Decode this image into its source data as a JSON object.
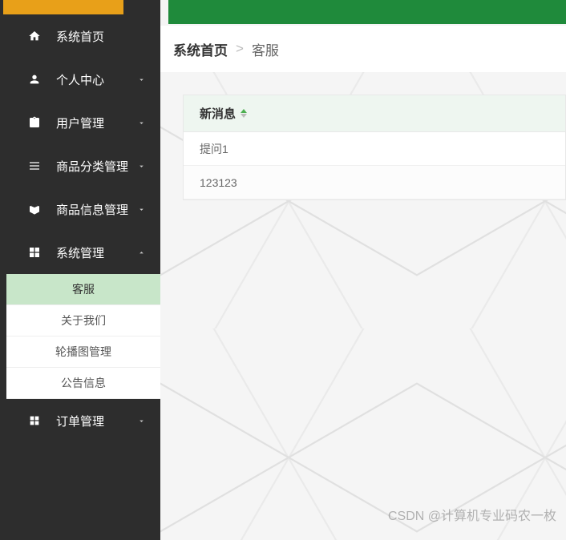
{
  "sidebar": {
    "items": [
      {
        "label": "系统首页",
        "icon": "home-icon",
        "expandable": false
      },
      {
        "label": "个人中心",
        "icon": "user-icon",
        "expandable": true,
        "open": false
      },
      {
        "label": "用户管理",
        "icon": "clipboard-icon",
        "expandable": true,
        "open": false
      },
      {
        "label": "商品分类管理",
        "icon": "list-icon",
        "expandable": true,
        "open": false
      },
      {
        "label": "商品信息管理",
        "icon": "tag-icon",
        "expandable": true,
        "open": false
      },
      {
        "label": "系统管理",
        "icon": "grid-icon",
        "expandable": true,
        "open": true
      },
      {
        "label": "订单管理",
        "icon": "grid2-icon",
        "expandable": true,
        "open": false
      }
    ],
    "submenu_system": [
      {
        "label": "客服",
        "active": true
      },
      {
        "label": "关于我们",
        "active": false
      },
      {
        "label": "轮播图管理",
        "active": false
      },
      {
        "label": "公告信息",
        "active": false
      }
    ]
  },
  "breadcrumb": {
    "root": "系统首页",
    "sep": ">",
    "current": "客服"
  },
  "table": {
    "header": "新消息",
    "rows": [
      "提问1",
      "123123"
    ]
  },
  "watermark": "CSDN @计算机专业码农一枚",
  "colors": {
    "brand_green": "#1f8a3b",
    "accent_orange": "#e8a019",
    "sidebar_bg": "#2d2d2d",
    "submenu_active": "#c8e6c9"
  }
}
